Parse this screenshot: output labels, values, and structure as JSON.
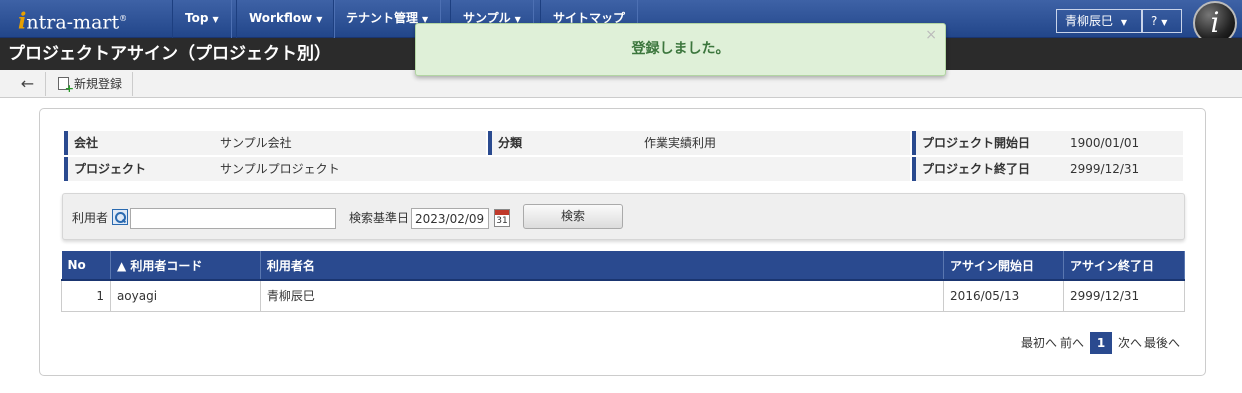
{
  "header": {
    "logo": "intra-mart",
    "nav": [
      {
        "label": "Top"
      },
      {
        "label": "Workflow"
      },
      {
        "label": "テナント管理"
      },
      {
        "label": "サンプル"
      },
      {
        "label": "サイトマップ"
      }
    ],
    "user": "青柳辰巳",
    "help": "?"
  },
  "page": {
    "title": "プロジェクトアサイン（プロジェクト別）"
  },
  "toolbar": {
    "back": "←",
    "new_label": "新規登録"
  },
  "toast": {
    "message": "登録しました。",
    "close": "×"
  },
  "info": {
    "company_label": "会社",
    "company_value": "サンプル会社",
    "category_label": "分類",
    "category_value": "作業実績利用",
    "start_label": "プロジェクト開始日",
    "start_value": "1900/01/01",
    "project_label": "プロジェクト",
    "project_value": "サンプルプロジェクト",
    "end_label": "プロジェクト終了日",
    "end_value": "2999/12/31"
  },
  "search": {
    "user_label": "利用者",
    "user_value": "",
    "date_label": "検索基準日",
    "date_value": "2023/02/09",
    "calendar_day": "31",
    "button": "検索"
  },
  "table": {
    "headers": [
      "No",
      "▲ 利用者コード",
      "利用者名",
      "アサイン開始日",
      "アサイン終了日"
    ],
    "rows": [
      {
        "no": "1",
        "code": "aoyagi",
        "name": "青柳辰巳",
        "start": "2016/05/13",
        "end": "2999/12/31"
      }
    ]
  },
  "pager": {
    "first": "最初へ",
    "prev": "前へ",
    "current": "1",
    "next": "次へ",
    "last": "最後へ"
  }
}
